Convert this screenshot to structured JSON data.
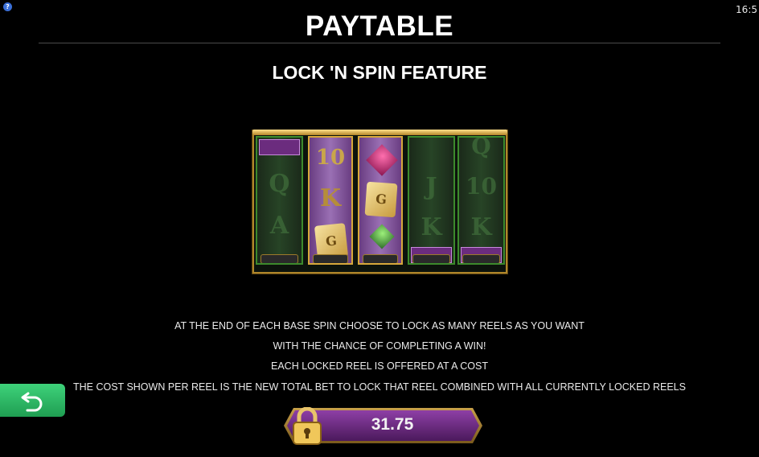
{
  "status": {
    "help_glyph": "?",
    "clock": "16:5"
  },
  "header": {
    "title": "PAYTABLE",
    "subtitle": "LOCK 'N SPIN FEATURE"
  },
  "reel_image": {
    "reel1_symbols": [
      "Q",
      "A"
    ],
    "reel2_symbols": [
      "10",
      "K"
    ],
    "reel3_symbols": [],
    "reel4_symbols": [
      "J",
      "K"
    ],
    "reel5_symbols": [
      "Q",
      "10",
      "K"
    ],
    "locked_reels": [
      2,
      3
    ],
    "colors": {
      "gold": "#b0862a",
      "locked": "#9a70b4",
      "unlocked": "#274426"
    }
  },
  "info_lines": [
    "AT THE END OF EACH BASE SPIN CHOOSE TO LOCK AS MANY REELS AS YOU WANT",
    "WITH THE CHANCE OF COMPLETING A WIN!",
    "EACH LOCKED REEL IS OFFERED AT A COST",
    "THE COST SHOWN PER REEL IS THE NEW TOTAL BET TO LOCK THAT REEL COMBINED WITH ALL CURRENTLY LOCKED REELS"
  ],
  "back_button": {
    "icon": "back-arrow-icon",
    "color": "#2fbf68"
  },
  "bet": {
    "value": "31.75",
    "icon": "padlock-icon"
  }
}
